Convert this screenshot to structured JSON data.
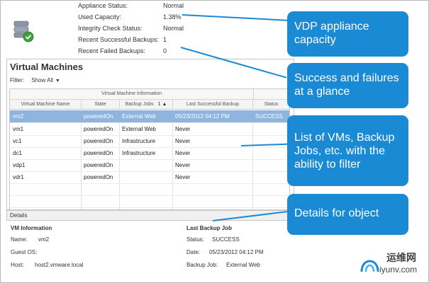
{
  "appliance": {
    "rows": [
      {
        "label": "Appliance Status:",
        "value": "Normal"
      },
      {
        "label": "Used Capacity:",
        "value": "1.38%"
      },
      {
        "label": "Integrity Check Status:",
        "value": "Normal"
      },
      {
        "label": "Recent Successful Backups:",
        "value": "1"
      },
      {
        "label": "Recent Failed Backups:",
        "value": "0"
      }
    ],
    "icon": "appliance-db-check-icon"
  },
  "vm_panel": {
    "title": "Virtual Machines",
    "filter_label": "Filter:",
    "filter_value": "Show All",
    "group_header": "Virtual Machine Information",
    "columns": [
      "Virtual Machine Name",
      "State",
      "Backup Jobs",
      "Last Successful Backup",
      "Status"
    ],
    "sort_indicator": "1 ▲",
    "rows": [
      {
        "name": "vm2",
        "state": "poweredOn",
        "job": "External Web",
        "last": "05/23/2012 04:12 PM",
        "status": "SUCCESS"
      },
      {
        "name": "vm1",
        "state": "poweredOn",
        "job": "External Web",
        "last": "Never",
        "status": ""
      },
      {
        "name": "vc1",
        "state": "poweredOn",
        "job": "Infrastructure",
        "last": "Never",
        "status": ""
      },
      {
        "name": "dc1",
        "state": "poweredOn",
        "job": "Infrastructure",
        "last": "Never",
        "status": ""
      },
      {
        "name": "vdp1",
        "state": "poweredOn",
        "job": "",
        "last": "Never",
        "status": ""
      },
      {
        "name": "vdr1",
        "state": "poweredOn",
        "job": "",
        "last": "Never",
        "status": ""
      }
    ]
  },
  "details": {
    "header": "Details",
    "vm_info_title": "VM Information",
    "name_label": "Name:",
    "name_value": "vm2",
    "guest_label": "Guest OS:",
    "host_label": "Host:",
    "host_value": "host2.vmware.local",
    "last_job_title": "Last Backup Job",
    "status_label": "Status:",
    "status_value": "SUCCESS",
    "date_label": "Date:",
    "date_value": "05/23/2012 04:12 PM",
    "backup_job_label": "Backup Job:",
    "backup_job_value": "External Web"
  },
  "callouts": {
    "c1": "VDP appliance capacity",
    "c2": "Success and failures at a glance",
    "c3": "List of VMs, Backup Jobs, etc. with the ability to filter",
    "c4": "Details for object"
  },
  "watermark": {
    "line1": "运维网",
    "line2": "iyunv.com"
  },
  "colors": {
    "accent": "#1a8ad4",
    "selected_row": "#8fb4dd"
  }
}
